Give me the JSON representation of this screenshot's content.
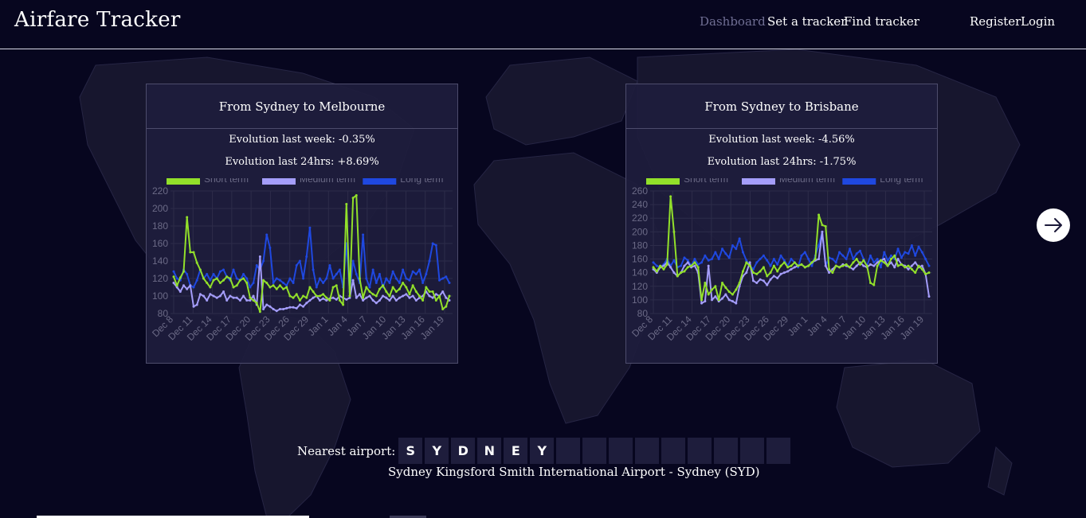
{
  "nav": {
    "brand": "Airfare Tracker",
    "links": [
      "Dashboard",
      "Set a tracker",
      "Find tracker"
    ],
    "register": "Register",
    "login": "Login"
  },
  "colors": {
    "background": "#07061f",
    "short": "#92e02a",
    "medium": "#a49dfa",
    "long": "#1f48e0",
    "nav_active": "#6f6e93"
  },
  "cards": [
    {
      "title": "From Sydney to Melbourne",
      "evo_week": "Evolution last week: -0.35%",
      "evo_24h": "Evolution last 24hrs: +8.69%"
    },
    {
      "title": "From Sydney to Brisbane",
      "evo_week": "Evolution last week: -4.56%",
      "evo_24h": "Evolution last 24hrs: -1.75%"
    }
  ],
  "chart_data": [
    {
      "type": "line",
      "legend_position": "top",
      "ylim": [
        80,
        220
      ],
      "yticks": [
        80,
        100,
        120,
        140,
        160,
        180,
        200,
        220
      ],
      "x_start": "Dec 8",
      "x_end": "Jan 21",
      "xtick_labels": [
        "Dec 8",
        "Dec 11",
        "Dec 14",
        "Dec 17",
        "Dec 20",
        "Dec 23",
        "Dec 26",
        "Dec 29",
        "Jan 1",
        "Jan 4",
        "Jan 7",
        "Jan 10",
        "Jan 13",
        "Jan 16",
        "Jan 19"
      ],
      "series": [
        {
          "name": "Short term",
          "values": [
            122,
            112,
            121,
            128,
            190,
            150,
            150,
            138,
            130,
            120,
            115,
            110,
            118,
            120,
            115,
            118,
            122,
            120,
            110,
            112,
            118,
            120,
            115,
            98,
            95,
            92,
            82,
            118,
            115,
            110,
            112,
            108,
            112,
            108,
            110,
            100,
            98,
            102,
            95,
            100,
            98,
            110,
            105,
            100,
            100,
            102,
            98,
            95,
            110,
            112,
            95,
            90,
            205,
            100,
            212,
            215,
            120,
            98,
            110,
            105,
            102,
            100,
            108,
            112,
            105,
            100,
            110,
            105,
            108,
            115,
            110,
            102,
            112,
            105,
            100,
            95,
            110,
            105,
            105,
            95,
            100,
            85,
            88,
            100
          ]
        },
        {
          "name": "Medium term",
          "values": [
            115,
            110,
            105,
            112,
            108,
            112,
            88,
            90,
            102,
            100,
            95,
            102,
            100,
            98,
            100,
            105,
            95,
            100,
            98,
            98,
            95,
            100,
            95,
            95,
            100,
            90,
            145,
            85,
            90,
            88,
            85,
            83,
            85,
            85,
            86,
            87,
            87,
            86,
            90,
            88,
            92,
            95,
            98,
            100,
            95,
            97,
            95,
            97,
            98,
            96,
            100,
            98,
            96,
            98,
            118,
            98,
            102,
            95,
            98,
            100,
            95,
            92,
            95,
            100,
            98,
            95,
            100,
            95,
            98,
            100,
            102,
            98,
            100,
            95,
            98,
            100,
            105,
            100,
            98,
            102,
            100,
            105,
            98,
            95
          ]
        },
        {
          "name": "Long term",
          "values": [
            128,
            120,
            118,
            130,
            125,
            112,
            110,
            118,
            130,
            120,
            125,
            118,
            125,
            120,
            128,
            130,
            122,
            118,
            130,
            120,
            118,
            125,
            120,
            110,
            115,
            135,
            130,
            140,
            170,
            155,
            115,
            120,
            118,
            115,
            112,
            120,
            115,
            135,
            140,
            120,
            145,
            178,
            130,
            110,
            120,
            115,
            120,
            135,
            120,
            125,
            130,
            110,
            160,
            105,
            140,
            125,
            115,
            170,
            120,
            110,
            130,
            115,
            125,
            110,
            120,
            115,
            128,
            120,
            115,
            130,
            120,
            118,
            128,
            125,
            130,
            115,
            125,
            140,
            160,
            158,
            118,
            120,
            122,
            115
          ]
        }
      ]
    },
    {
      "type": "line",
      "legend_position": "top",
      "ylim": [
        80,
        260
      ],
      "yticks": [
        80,
        100,
        120,
        140,
        160,
        180,
        200,
        220,
        240,
        260
      ],
      "x_start": "Dec 8",
      "x_end": "Jan 21",
      "xtick_labels": [
        "Dec 8",
        "Dec 11",
        "Dec 14",
        "Dec 17",
        "Dec 20",
        "Dec 23",
        "Dec 26",
        "Dec 29",
        "Jan 1",
        "Jan 4",
        "Jan 7",
        "Jan 10",
        "Jan 13",
        "Jan 16",
        "Jan 19"
      ],
      "series": [
        {
          "name": "Short term",
          "values": [
            148,
            142,
            150,
            145,
            152,
            252,
            200,
            135,
            140,
            142,
            148,
            150,
            155,
            148,
            100,
            125,
            108,
            115,
            120,
            100,
            125,
            118,
            112,
            108,
            115,
            125,
            142,
            155,
            150,
            140,
            138,
            142,
            148,
            135,
            140,
            150,
            142,
            150,
            155,
            148,
            150,
            155,
            150,
            152,
            148,
            150,
            155,
            160,
            225,
            210,
            208,
            145,
            140,
            150,
            148,
            150,
            152,
            148,
            155,
            160,
            152,
            158,
            150,
            125,
            122,
            150,
            158,
            155,
            150,
            160,
            165,
            150,
            152,
            148,
            150,
            145,
            140,
            150,
            145,
            138,
            140
          ]
        },
        {
          "name": "Medium term",
          "values": [
            145,
            140,
            148,
            150,
            155,
            148,
            140,
            135,
            140,
            150,
            155,
            148,
            150,
            140,
            95,
            98,
            150,
            100,
            105,
            98,
            102,
            108,
            100,
            98,
            95,
            120,
            135,
            140,
            155,
            128,
            125,
            130,
            128,
            122,
            130,
            135,
            132,
            138,
            140,
            142,
            145,
            148,
            150,
            152,
            148,
            150,
            155,
            158,
            160,
            200,
            150,
            140,
            145,
            150,
            148,
            152,
            150,
            148,
            145,
            150,
            155,
            150,
            148,
            152,
            150,
            155,
            158,
            160,
            150,
            155,
            148,
            160,
            152,
            150,
            145,
            150,
            155,
            148,
            150,
            138,
            105
          ]
        },
        {
          "name": "Long term",
          "values": [
            155,
            150,
            148,
            152,
            160,
            150,
            158,
            148,
            150,
            162,
            158,
            150,
            160,
            152,
            155,
            165,
            158,
            160,
            170,
            160,
            175,
            168,
            162,
            180,
            175,
            190,
            170,
            158,
            150,
            145,
            155,
            160,
            165,
            158,
            150,
            160,
            152,
            165,
            158,
            150,
            160,
            155,
            148,
            165,
            170,
            160,
            150,
            165,
            180,
            200,
            150,
            162,
            160,
            155,
            170,
            165,
            160,
            175,
            160,
            168,
            172,
            160,
            150,
            165,
            155,
            160,
            148,
            170,
            158,
            165,
            160,
            175,
            162,
            170,
            168,
            180,
            165,
            178,
            170,
            160,
            150
          ]
        }
      ]
    }
  ],
  "airport": {
    "label": "Nearest airport:",
    "letters": [
      "S",
      "Y",
      "D",
      "N",
      "E",
      "Y",
      "",
      "",
      "",
      "",
      "",
      "",
      "",
      "",
      ""
    ],
    "full_name": "Sydney Kingsford Smith International Airport - Sydney (SYD)"
  },
  "icons": {
    "next": "arrow-right-icon"
  }
}
